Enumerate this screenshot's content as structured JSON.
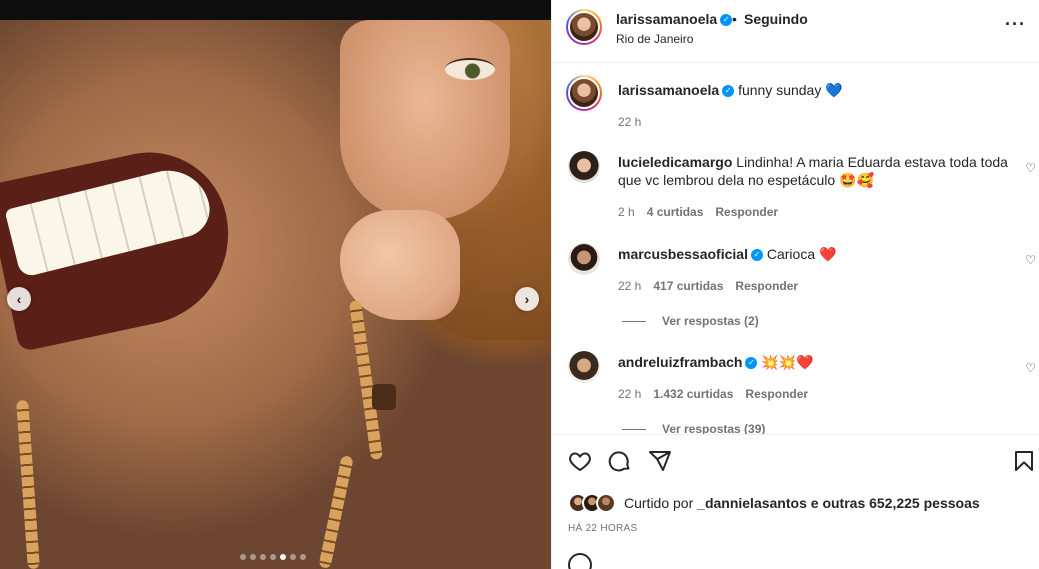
{
  "post": {
    "author": "larissamanoela",
    "follow_status": "Seguindo",
    "location": "Rio de Janeiro",
    "caption": "funny sunday",
    "caption_time": "22 h",
    "carousel": {
      "total": 7,
      "active": 5
    }
  },
  "comments": [
    {
      "username": "lucieledicamargo",
      "text": "Lindinha! A maria Eduarda estava toda toda que vc lembrou dela no espetáculo 🤩🥰",
      "time": "2 h",
      "likes": "4 curtidas",
      "reply": "Responder"
    },
    {
      "username": "marcusbessaoficial",
      "text": "Carioca ❤️",
      "time": "22 h",
      "likes": "417 curtidas",
      "reply": "Responder",
      "view_replies": "Ver respostas (2)"
    },
    {
      "username": "andreluizframbach",
      "text": "💥💥❤️",
      "time": "22 h",
      "likes": "1.432 curtidas",
      "reply": "Responder",
      "view_replies": "Ver respostas (39)"
    }
  ],
  "likes_line": {
    "prefix": "Curtido por",
    "user": "_dannielasantos",
    "middle": "e",
    "others": "outras 652,225 pessoas"
  },
  "timestamp": "HÁ 22 HORAS",
  "icons": {
    "verified": "verified-badge",
    "more": "more-icon",
    "heart": "heart-icon",
    "comment": "comment-icon",
    "share": "share-icon",
    "save": "bookmark-icon"
  }
}
